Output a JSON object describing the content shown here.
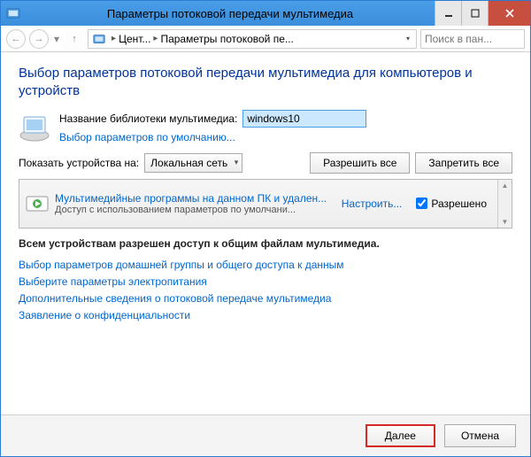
{
  "window": {
    "title": "Параметры потоковой передачи мультимедиа"
  },
  "nav": {
    "back": "←",
    "forward": "→",
    "up": "↑",
    "crumb1": "Цент...",
    "crumb2": "Параметры потоковой пе...",
    "search_placeholder": "Поиск в пан..."
  },
  "main": {
    "heading": "Выбор параметров потоковой передачи мультимедиа для компьютеров и устройств",
    "library_label": "Название библиотеки мультимедиа:",
    "library_value": "windows10",
    "defaults_link": "Выбор параметров по умолчанию...",
    "show_label": "Показать устройства на:",
    "show_value": "Локальная сеть",
    "allow_all": "Разрешить все",
    "block_all": "Запретить все",
    "device": {
      "name": "Мультимедийные программы на данном ПК и удален...",
      "sub": "Доступ с использованием параметров по умолчани...",
      "configure": "Настроить...",
      "allowed_label": "Разрешено"
    },
    "status": "Всем устройствам разрешен доступ к общим файлам мультимедиа.",
    "links": {
      "l1": "Выбор параметров домашней группы и общего доступа к данным",
      "l2": "Выберите параметры электропитания",
      "l3": "Дополнительные сведения о потоковой передаче мультимедиа",
      "l4": "Заявление о конфиденциальности"
    }
  },
  "footer": {
    "next": "Далее",
    "cancel": "Отмена"
  }
}
